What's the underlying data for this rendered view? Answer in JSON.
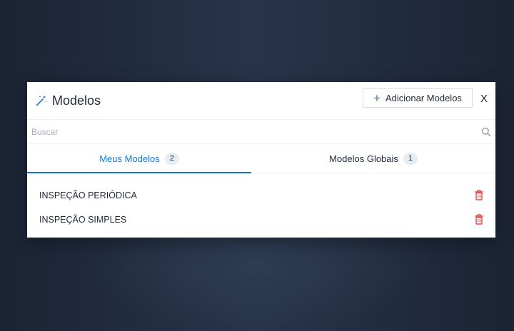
{
  "modal": {
    "title": "Modelos",
    "add_button_label": "Adicionar Modelos",
    "close_label": "X"
  },
  "search": {
    "placeholder": "Buscar",
    "value": ""
  },
  "tabs": [
    {
      "label": "Meus Modelos",
      "count": "2",
      "active": true
    },
    {
      "label": "Modelos Globais",
      "count": "1",
      "active": false
    }
  ],
  "list": {
    "items": [
      {
        "label": "INSPEÇÃO PERIÓDICA"
      },
      {
        "label": "INSPEÇÃO SIMPLES"
      }
    ]
  },
  "icons": {
    "title_icon": "magic-wand-icon",
    "search_icon": "search-icon",
    "delete_icon": "trash-icon",
    "add_icon": "plus-icon"
  },
  "colors": {
    "accent": "#1976d2",
    "delete": "#d32f2f",
    "badge_bg": "#e6edf5"
  }
}
